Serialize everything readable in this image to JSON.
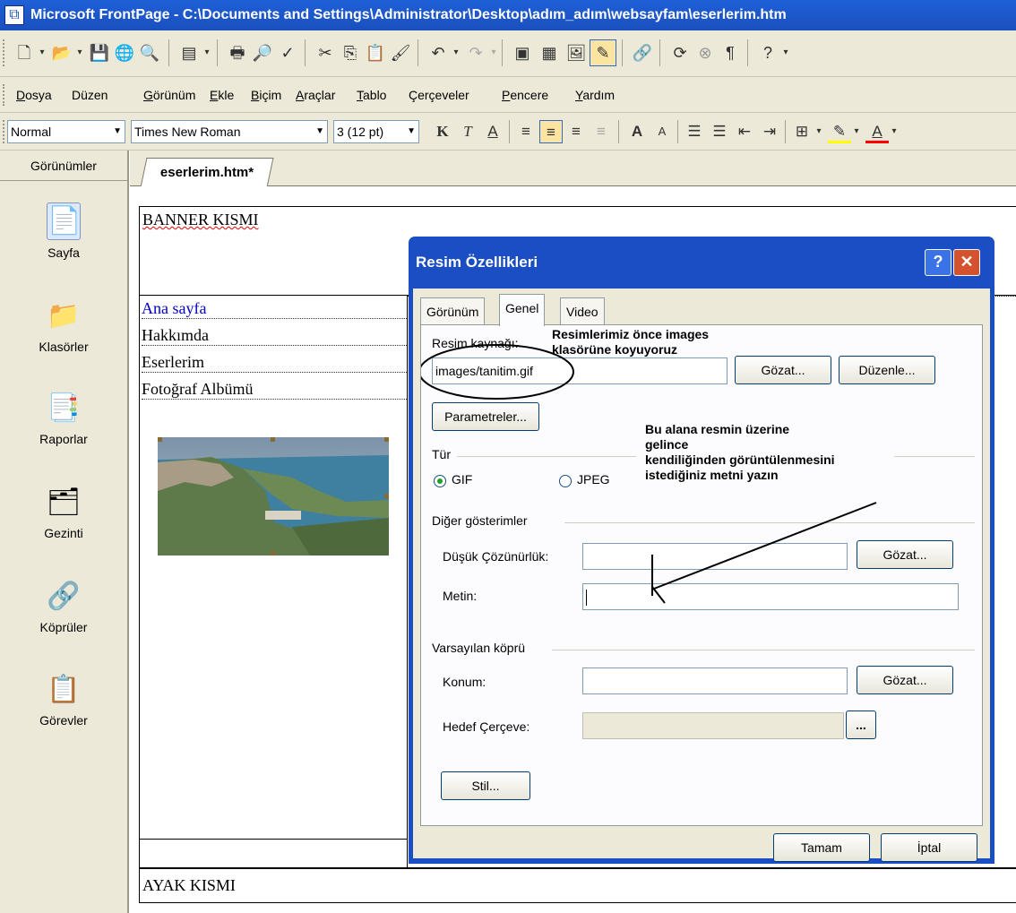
{
  "window": {
    "title": "Microsoft FrontPage - C:\\Documents and Settings\\Administrator\\Desktop\\adım_adım\\websayfam\\eserlerim.htm",
    "app_icon": "frontpage-app-icon"
  },
  "menubar": {
    "items": [
      {
        "label": "Dosya",
        "key": "D"
      },
      {
        "label": "Düzen",
        "key": ""
      },
      {
        "label": "Görünüm",
        "key": "G"
      },
      {
        "label": "Ekle",
        "key": "E"
      },
      {
        "label": "Biçim",
        "key": "B"
      },
      {
        "label": "Araçlar",
        "key": "A"
      },
      {
        "label": "Tablo",
        "key": "T"
      },
      {
        "label": "Çerçeveler",
        "key": "v"
      },
      {
        "label": "Pencere",
        "key": "P"
      },
      {
        "label": "Yardım",
        "key": "Y"
      }
    ]
  },
  "formatting": {
    "style": "Normal",
    "font": "Times New Roman",
    "size": "3 (12 pt)"
  },
  "views_panel": {
    "header": "Görünümler",
    "items": [
      {
        "label": "Sayfa",
        "icon": "page-view-icon"
      },
      {
        "label": "Klasörler",
        "icon": "folders-icon"
      },
      {
        "label": "Raporlar",
        "icon": "reports-icon"
      },
      {
        "label": "Gezinti",
        "icon": "navigation-icon"
      },
      {
        "label": "Köprüler",
        "icon": "hyperlinks-icon"
      },
      {
        "label": "Görevler",
        "icon": "tasks-icon"
      }
    ]
  },
  "editor": {
    "tab": "eserlerim.htm*",
    "banner": "BANNER KISMI",
    "nav_links": [
      "Ana sayfa",
      "Hakkımda",
      "Eserlerim",
      "Fotoğraf Albümü"
    ],
    "footer": "AYAK KISMI",
    "link_color": "#0000cc"
  },
  "dialog": {
    "title": "Resim Özellikleri",
    "tabs": [
      "Görünüm",
      "Genel",
      "Video"
    ],
    "active_tab": "Genel",
    "source_label": "Resim kaynağı:",
    "source_value": "images/tanitim.gif",
    "browse_label": "Gözat...",
    "edit_label": "Düzenle...",
    "params_label": "Parametreler...",
    "type_label": "Tür",
    "type_gif": "GIF",
    "type_jpeg": "JPEG",
    "type_selected": "GIF",
    "alt_group": "Diğer gösterimler",
    "lowres_label": "Düşük Çözünürlük:",
    "text_label": "Metin:",
    "link_group": "Varsayılan köprü",
    "location_label": "Konum:",
    "target_label": "Hedef Çerçeve:",
    "target_btn": "...",
    "style_label": "Stil...",
    "ok_label": "Tamam",
    "cancel_label": "İptal",
    "help_btn": "?",
    "close_btn": "✕"
  },
  "annotations": {
    "note1_line1": "Resimlerimiz önce images",
    "note1_line2": "klasörüne koyuyoruz",
    "note2_line1": "Bu alana resmin üzerine",
    "note2_line2": "gelince",
    "note2_line3": "kendiliğinden görüntülenmesini",
    "note2_line4": "istediğiniz metni yazın"
  }
}
